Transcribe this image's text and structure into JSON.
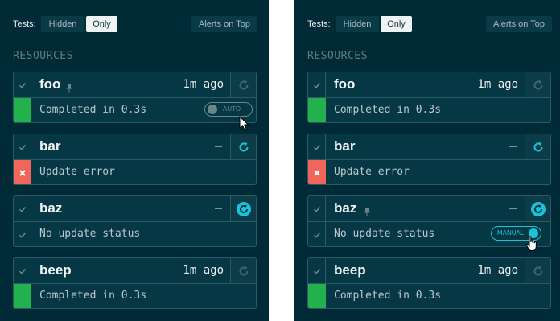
{
  "header": {
    "tests_label": "Tests:",
    "segments": [
      "Hidden",
      "Only"
    ],
    "selected_segment": "Only",
    "alerts_button": "Alerts on Top"
  },
  "section_title": "RESOURCES",
  "panels": [
    {
      "resources": [
        {
          "name": "foo",
          "pinned": true,
          "time": "1m ago",
          "status": "success",
          "message": "Completed in 0.3s",
          "trigger": "inactive",
          "toggle": "AUTO"
        },
        {
          "name": "bar",
          "pinned": false,
          "time": "–",
          "status": "error",
          "message": "Update error",
          "trigger": "active"
        },
        {
          "name": "baz",
          "pinned": false,
          "time": "–",
          "status": "none",
          "message": "No update status",
          "trigger": "pending"
        },
        {
          "name": "beep",
          "pinned": false,
          "time": "1m ago",
          "status": "success",
          "message": "Completed in 0.3s",
          "trigger": "inactive"
        }
      ]
    },
    {
      "resources": [
        {
          "name": "foo",
          "pinned": false,
          "time": "1m ago",
          "status": "success",
          "message": "Completed in 0.3s",
          "trigger": "inactive"
        },
        {
          "name": "bar",
          "pinned": false,
          "time": "–",
          "status": "error",
          "message": "Update error",
          "trigger": "active"
        },
        {
          "name": "baz",
          "pinned": true,
          "time": "–",
          "status": "none",
          "message": "No update status",
          "trigger": "pending",
          "toggle": "MANUAL"
        },
        {
          "name": "beep",
          "pinned": false,
          "time": "1m ago",
          "status": "success",
          "message": "Completed in 0.3s",
          "trigger": "inactive"
        }
      ]
    }
  ],
  "colors": {
    "background": "#002b36",
    "card": "#063744",
    "success": "#22b14c",
    "error": "#f0665b",
    "accent": "#19c4d8",
    "muted": "#6a868c"
  },
  "icons": {
    "check": "check-icon",
    "pin": "pin-icon",
    "refresh": "refresh-icon",
    "error": "x-icon",
    "cursor_arrow": "arrow-cursor-icon",
    "cursor_hand": "hand-cursor-icon"
  }
}
